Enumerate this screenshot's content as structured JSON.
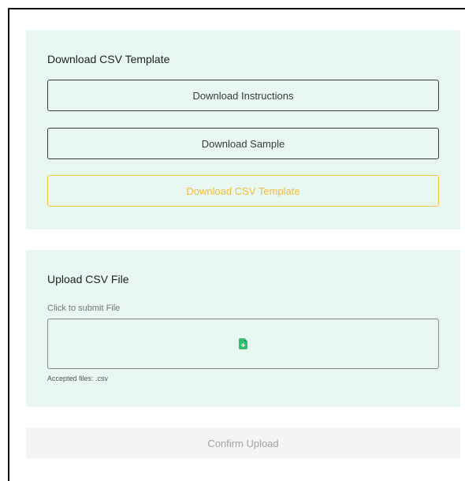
{
  "download_section": {
    "title": "Download CSV Template",
    "instructions_label": "Download Instructions",
    "sample_label": "Download Sample",
    "template_label": "Download CSV Template"
  },
  "upload_section": {
    "title": "Upload CSV File",
    "hint": "Click to submit File",
    "accepted": "Accepted files: .csv",
    "icon": "file-add-icon"
  },
  "confirm": {
    "label": "Confirm Upload"
  },
  "colors": {
    "panel_bg": "#e8f8f0",
    "accent": "#f3bb3a",
    "icon_green": "#2fbf71",
    "frame_border": "#111111"
  }
}
